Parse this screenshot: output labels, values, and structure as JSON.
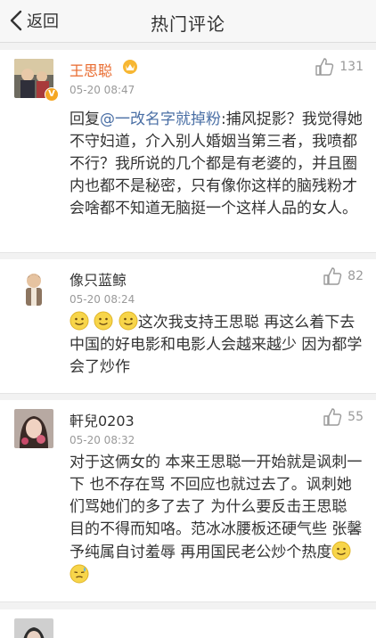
{
  "header": {
    "back_label": "返回",
    "title": "热门评论"
  },
  "comments": [
    {
      "user": "王思聪",
      "time": "05-20 08:47",
      "likes": "131",
      "reply_prefix": "回复",
      "mention": "@一改名字就掉粉",
      "text": ":捕风捉影？我觉得她不守妇道，介入别人婚姻当第三者，我喷都不行？我所说的几个都是有老婆的，并且圈内也都不是秘密，只有像你这样的脑残粉才会啥都不知道无脑挺一个这样人品的女人。"
    },
    {
      "user": "像只蓝鲸",
      "time": "05-20 08:24",
      "likes": "82",
      "text": "这次我支持王思聪 再这么着下去 中国的好电影和电影人会越来越少 因为都学会了炒作"
    },
    {
      "user": "軒兒0203",
      "time": "05-20 08:32",
      "likes": "55",
      "text": "对于这俩女的 本来王思聪一开始就是讽刺一下 也不存在骂 不回应也就过去了。讽刺她们骂她们的多了去了 为什么要反击王思聪 目的不得而知咯。范冰冰腰板还硬气些 张馨予纯属自讨羞辱 再用国民老公炒个热度"
    }
  ],
  "colors": {
    "vip_name": "#e8692c",
    "mention": "#4a6fa5",
    "meta": "#9a9a9a"
  }
}
